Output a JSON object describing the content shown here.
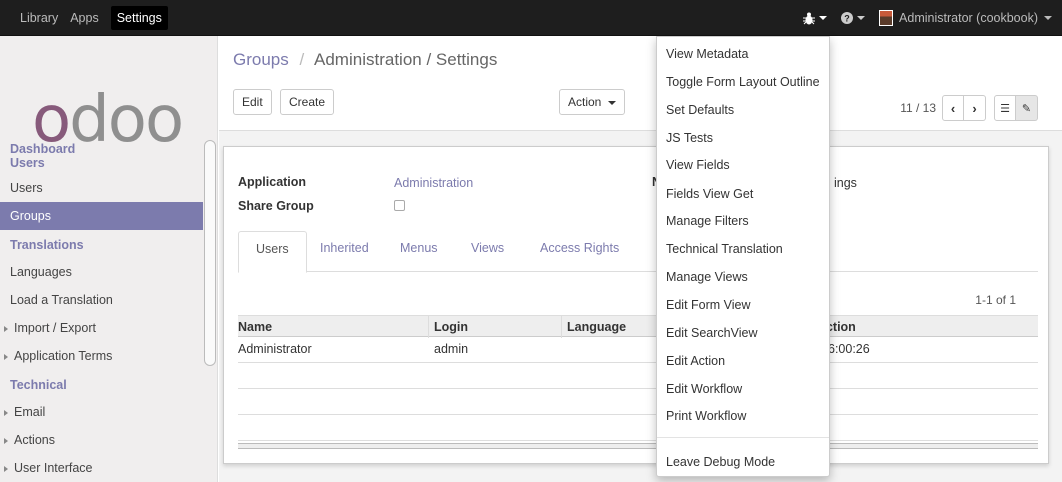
{
  "topbar": {
    "menus": [
      "Library",
      "Apps",
      "Settings"
    ],
    "active_menu": "Settings",
    "user": "Administrator (cookbook)"
  },
  "sidebar": {
    "logo": "odoo",
    "sections": [
      {
        "title": "Dashboard",
        "items": []
      },
      {
        "title": "Users",
        "items": [
          "Users",
          "Groups"
        ]
      },
      {
        "title": "Translations",
        "items": [
          "Languages",
          "Load a Translation",
          "Import / Export",
          "Application Terms"
        ]
      },
      {
        "title": "Technical",
        "items": [
          "Email",
          "Actions",
          "User Interface"
        ]
      }
    ],
    "selected": "Groups"
  },
  "breadcrumb": {
    "first": "Groups",
    "rest": "Administration / Settings",
    "sep": "/"
  },
  "buttons": {
    "edit": "Edit",
    "create": "Create",
    "action": "Action"
  },
  "pager": {
    "count": "11 / 13",
    "records": "1-1 of 1"
  },
  "form": {
    "application_label": "Application",
    "application_value": "Administration",
    "share_group_label": "Share Group",
    "name_label_partial": "N",
    "name_value_partial": "ings"
  },
  "tabs": [
    "Users",
    "Inherited",
    "Menus",
    "Views",
    "Access Rights"
  ],
  "table": {
    "columns": [
      "Name",
      "Login",
      "Language",
      "ection"
    ],
    "rows": [
      {
        "name": "Administrator",
        "login": "admin",
        "language": "",
        "date": "6:00:26"
      }
    ]
  },
  "debug_menu": {
    "items": [
      "View Metadata",
      "Toggle Form Layout Outline",
      "Set Defaults",
      "JS Tests",
      "View Fields",
      "Fields View Get",
      "Manage Filters",
      "Technical Translation",
      "Manage Views",
      "Edit Form View",
      "Edit SearchView",
      "Edit Action",
      "Edit Workflow",
      "Print Workflow"
    ],
    "leave": "Leave Debug Mode"
  },
  "colors": {
    "accent": "#7c7bad",
    "brand": "#875a7b",
    "topbar": "#1e1e1e"
  }
}
